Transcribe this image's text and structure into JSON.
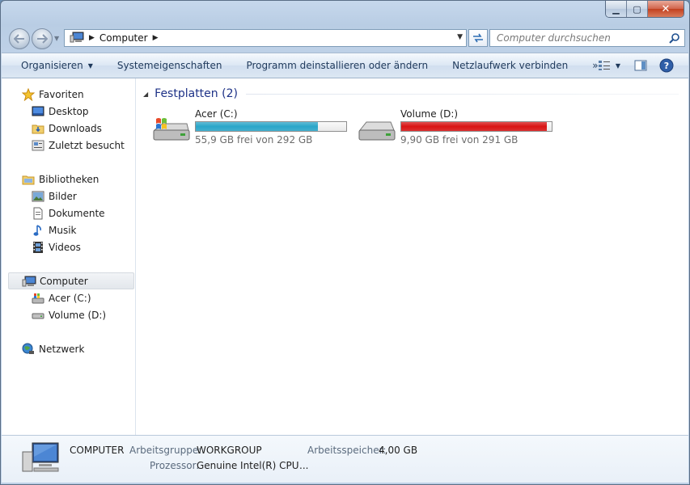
{
  "window": {
    "caption": {
      "minimize": "▁",
      "maximize": "▢",
      "close": "✕"
    }
  },
  "address": {
    "crumb": "Computer",
    "search_placeholder": "Computer durchsuchen"
  },
  "toolbar": {
    "organize": "Organisieren",
    "system_properties": "Systemeigenschaften",
    "uninstall": "Programm deinstallieren oder ändern",
    "map_drive": "Netzlaufwerk verbinden",
    "more": "»"
  },
  "nav": {
    "favorites": "Favoriten",
    "desktop": "Desktop",
    "downloads": "Downloads",
    "recent": "Zuletzt besucht",
    "libraries": "Bibliotheken",
    "pictures": "Bilder",
    "documents": "Dokumente",
    "music": "Musik",
    "videos": "Videos",
    "computer": "Computer",
    "drive_c": "Acer (C:)",
    "drive_d": "Volume (D:)",
    "network": "Netzwerk"
  },
  "main": {
    "group_title": "Festplatten (2)",
    "drives": [
      {
        "name": "Acer (C:)",
        "free_text": "55,9 GB frei von 292 GB",
        "used_fraction": 0.81,
        "bar_color": "#2aa6c9"
      },
      {
        "name": "Volume (D:)",
        "free_text": "9,90 GB frei von 291 GB",
        "used_fraction": 0.97,
        "bar_color": "#d91414"
      }
    ]
  },
  "details": {
    "name": "COMPUTER",
    "workgroup_label": "Arbeitsgruppe:",
    "workgroup_value": "WORKGROUP",
    "memory_label": "Arbeitsspeicher:",
    "memory_value": "4,00 GB",
    "cpu_label": "Prozessor:",
    "cpu_value": "Genuine Intel(R) CPU",
    "cpu_more": "..."
  }
}
